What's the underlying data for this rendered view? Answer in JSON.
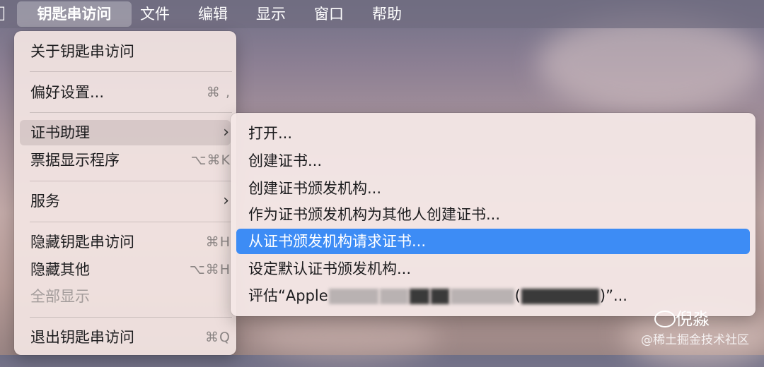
{
  "menubar": {
    "apple_icon": "apple-logo-icon",
    "items": [
      {
        "label": "钥匙串访问"
      },
      {
        "label": "文件"
      },
      {
        "label": "编辑"
      },
      {
        "label": "显示"
      },
      {
        "label": "窗口"
      },
      {
        "label": "帮助"
      }
    ]
  },
  "menu": {
    "about": "关于钥匙串访问",
    "preferences": {
      "label": "偏好设置...",
      "shortcut": "⌘ ,"
    },
    "cert_assistant": {
      "label": "证书助理",
      "arrow": "›"
    },
    "ticket_viewer": {
      "label": "票据显示程序",
      "shortcut": "⌥⌘K"
    },
    "services": {
      "label": "服务",
      "arrow": "›"
    },
    "hide_app": {
      "label": "隐藏钥匙串访问",
      "shortcut": "⌘H"
    },
    "hide_others": {
      "label": "隐藏其他",
      "shortcut": "⌥⌘H"
    },
    "show_all": {
      "label": "全部显示"
    },
    "quit": {
      "label": "退出钥匙串访问",
      "shortcut": "⌘Q"
    }
  },
  "submenu": {
    "items": [
      {
        "label": "打开..."
      },
      {
        "label": "创建证书..."
      },
      {
        "label": "创建证书颁发机构..."
      },
      {
        "label": "作为证书颁发机构为其他人创建证书..."
      },
      {
        "label": "从证书颁发机构请求证书..."
      },
      {
        "label": "设定默认证书颁发机构..."
      },
      {
        "label_prefix": "评估“Apple",
        "label_mid": "(",
        "label_suffix": ")”..."
      }
    ]
  },
  "watermark": {
    "name": "倪淼",
    "site": "@稀土掘金技术社区"
  }
}
